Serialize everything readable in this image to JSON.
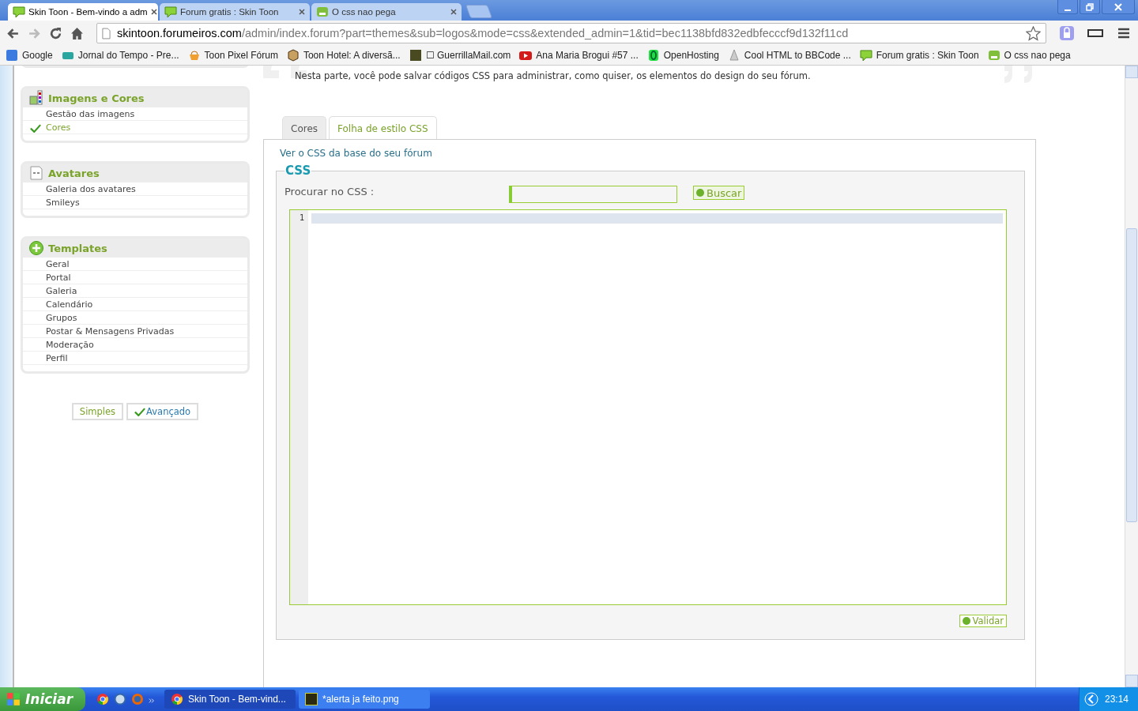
{
  "browser": {
    "tabs": [
      {
        "title": "Skin Toon - Bem-vindo a adm",
        "kind": "bubble",
        "selected": true
      },
      {
        "title": "Forum gratis : Skin Toon",
        "kind": "bubble",
        "selected": false
      },
      {
        "title": "O css nao pega",
        "kind": "face",
        "selected": false
      }
    ],
    "url_host": "skintoon.forumeiros.com",
    "url_path": "/admin/index.forum?part=themes&sub=logos&mode=css&extended_admin=1&tid=bec1138bfd832edbfecccf9d132f11cd",
    "bookmarks": [
      {
        "label": "Google",
        "kind": "blue"
      },
      {
        "label": "Jornal do Tempo - Pre...",
        "kind": "teal"
      },
      {
        "label": "Toon Pixel Fórum",
        "kind": "basket"
      },
      {
        "label": "Toon Hotel: A diversã...",
        "kind": "cube"
      },
      {
        "label": "☐ GuerrillaMail.com",
        "kind": "dark"
      },
      {
        "label": "Ana Maria Brogui #57 ...",
        "kind": "play"
      },
      {
        "label": "OpenHosting",
        "kind": "ring"
      },
      {
        "label": "Cool HTML to BBCode ...",
        "kind": "sail"
      },
      {
        "label": "Forum gratis : Skin Toon",
        "kind": "bubble"
      },
      {
        "label": "O css nao pega",
        "kind": "face"
      }
    ]
  },
  "sidebar": {
    "sections": [
      {
        "title": "Imagens e Cores",
        "kind": "palette",
        "items": [
          {
            "label": "Gestão das imagens",
            "selected": false
          },
          {
            "label": "Cores",
            "selected": true
          }
        ]
      },
      {
        "title": "Avatares",
        "kind": "mask",
        "items": [
          {
            "label": "Galeria dos avatares",
            "selected": false
          },
          {
            "label": "Smileys",
            "selected": false
          }
        ]
      },
      {
        "title": "Templates",
        "kind": "plus",
        "items": [
          {
            "label": "Geral",
            "selected": false
          },
          {
            "label": "Portal",
            "selected": false
          },
          {
            "label": "Galeria",
            "selected": false
          },
          {
            "label": "Calendário",
            "selected": false
          },
          {
            "label": "Grupos",
            "selected": false
          },
          {
            "label": "Postar & Mensagens Privadas",
            "selected": false
          },
          {
            "label": "Moderação",
            "selected": false
          },
          {
            "label": "Perfil",
            "selected": false
          }
        ]
      }
    ],
    "modes": [
      {
        "label": "Simples",
        "selected": false
      },
      {
        "label": "Avançado",
        "selected": true
      }
    ]
  },
  "main": {
    "description": "Nesta parte, você pode salvar códigos CSS para administrar, como quiser, os elementos do design do seu fórum.",
    "tabs": [
      {
        "label": "Cores",
        "selected": false
      },
      {
        "label": "Folha de estilo CSS",
        "selected": true
      }
    ],
    "base_css_link": "Ver o CSS da base do seu fórum",
    "legend": "CSS",
    "search_label": "Procurar no CSS :",
    "search_button": "Buscar",
    "line_numbers": [
      "1"
    ],
    "submit_button": "Validar"
  },
  "taskbar": {
    "start": "Iniciar",
    "windows": [
      {
        "title": "Skin Toon - Bem-vind...",
        "kind": "chrome",
        "selected": true
      },
      {
        "title": "*alerta ja feito.png",
        "kind": "fw",
        "selected": false
      }
    ],
    "clock": "23:14"
  }
}
